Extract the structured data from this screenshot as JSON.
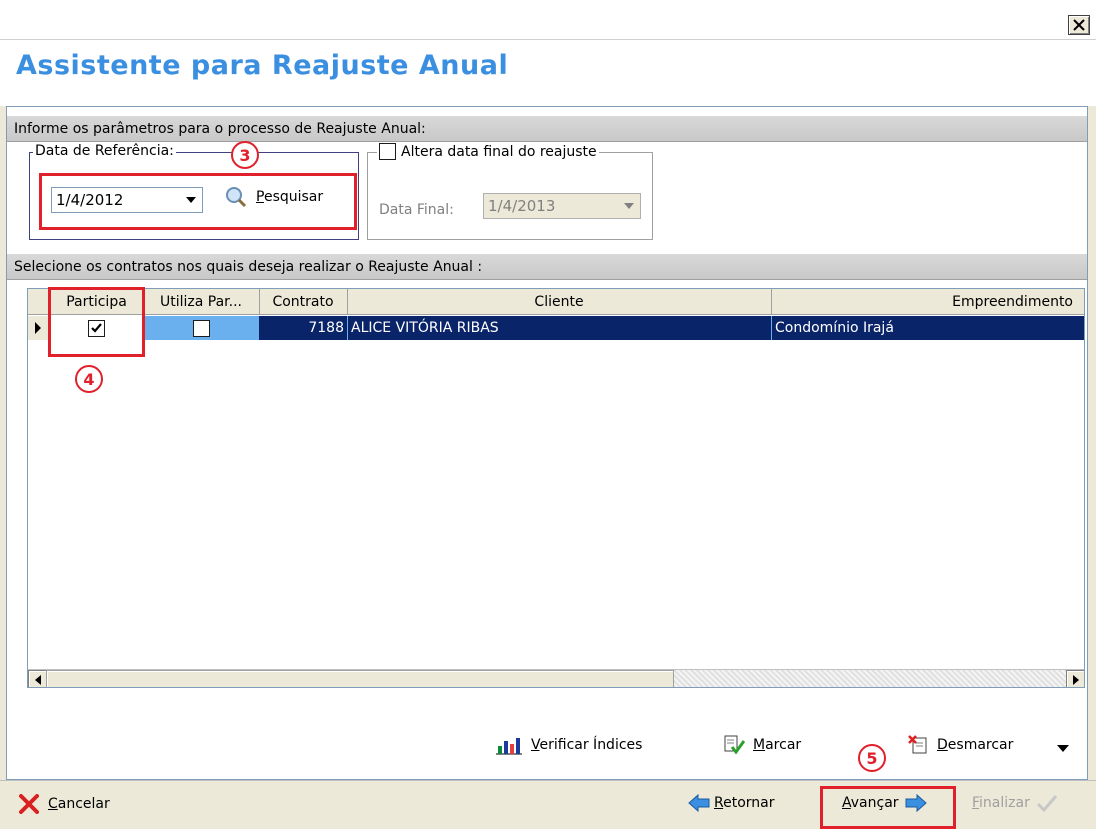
{
  "window": {
    "title": "Assistente para Reajuste Anual"
  },
  "params": {
    "section_title": "Informe os parâmetros para o processo de Reajuste Anual:",
    "ref_date_legend": "Data de Referência:",
    "ref_date_value": "1/4/2012",
    "search_label": "Pesquisar",
    "alter_end_label": "Altera data final do reajuste",
    "alter_end_checked": false,
    "final_date_label": "Data Final:",
    "final_date_value": "1/4/2013"
  },
  "contracts": {
    "section_title": "Selecione os contratos nos quais deseja realizar o Reajuste Anual :",
    "columns": [
      "Participa",
      "Utiliza Par...",
      "Contrato",
      "Cliente",
      "Empreendimento"
    ],
    "rows": [
      {
        "participa": true,
        "utiliza": false,
        "contrato": "7188",
        "cliente": "ALICE VITÓRIA RIBAS",
        "empreendimento": "Condomínio Irajá"
      }
    ]
  },
  "toolbar": {
    "verificar": "Verificar Índices",
    "marcar": "Marcar",
    "desmarcar": "Desmarcar"
  },
  "footer": {
    "cancelar": "Cancelar",
    "retornar": "Retornar",
    "avancar": "Avançar",
    "finalizar": "Finalizar"
  },
  "callouts": {
    "c3": "3",
    "c4": "4",
    "c5": "5"
  },
  "colors": {
    "title": "#3a8fe0",
    "selection": "#0a246a",
    "highlight": "#e0202a"
  }
}
